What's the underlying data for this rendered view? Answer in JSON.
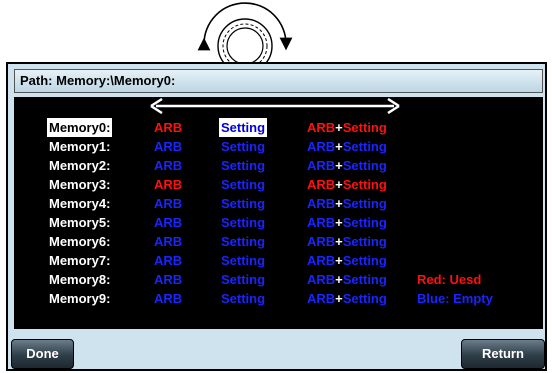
{
  "path_label": "Path: Memory:\\Memory0:",
  "rows": [
    {
      "name": "Memory0:",
      "arb": "ARB",
      "setting": "Setting",
      "both_a": "ARB",
      "both_plus": "+",
      "both_b": "Setting",
      "arb_color": "red",
      "setting_color": "selected",
      "both_color": "red",
      "legend": ""
    },
    {
      "name": "Memory1:",
      "arb": "ARB",
      "setting": "Setting",
      "both_a": "ARB",
      "both_plus": "+",
      "both_b": "Setting",
      "arb_color": "blue",
      "setting_color": "blue",
      "both_color": "blue",
      "legend": ""
    },
    {
      "name": "Memory2:",
      "arb": "ARB",
      "setting": "Setting",
      "both_a": "ARB",
      "both_plus": "+",
      "both_b": "Setting",
      "arb_color": "blue",
      "setting_color": "blue",
      "both_color": "blue",
      "legend": ""
    },
    {
      "name": "Memory3:",
      "arb": "ARB",
      "setting": "Setting",
      "both_a": "ARB",
      "both_plus": "+",
      "both_b": "Setting",
      "arb_color": "red",
      "setting_color": "blue",
      "both_color": "red",
      "legend": ""
    },
    {
      "name": "Memory4:",
      "arb": "ARB",
      "setting": "Setting",
      "both_a": "ARB",
      "both_plus": "+",
      "both_b": "Setting",
      "arb_color": "blue",
      "setting_color": "blue",
      "both_color": "blue",
      "legend": ""
    },
    {
      "name": "Memory5:",
      "arb": "ARB",
      "setting": "Setting",
      "both_a": "ARB",
      "both_plus": "+",
      "both_b": "Setting",
      "arb_color": "blue",
      "setting_color": "blue",
      "both_color": "blue",
      "legend": ""
    },
    {
      "name": "Memory6:",
      "arb": "ARB",
      "setting": "Setting",
      "both_a": "ARB",
      "both_plus": "+",
      "both_b": "Setting",
      "arb_color": "blue",
      "setting_color": "blue",
      "both_color": "blue",
      "legend": ""
    },
    {
      "name": "Memory7:",
      "arb": "ARB",
      "setting": "Setting",
      "both_a": "ARB",
      "both_plus": "+",
      "both_b": "Setting",
      "arb_color": "blue",
      "setting_color": "blue",
      "both_color": "blue",
      "legend": ""
    },
    {
      "name": "Memory8:",
      "arb": "ARB",
      "setting": "Setting",
      "both_a": "ARB",
      "both_plus": "+",
      "both_b": "Setting",
      "arb_color": "blue",
      "setting_color": "blue",
      "both_color": "blue",
      "legend": "Red: Uesd"
    },
    {
      "name": "Memory9:",
      "arb": "ARB",
      "setting": "Setting",
      "both_a": "ARB",
      "both_plus": "+",
      "both_b": "Setting",
      "arb_color": "blue",
      "setting_color": "blue",
      "both_color": "blue",
      "legend": "Blue: Empty"
    }
  ],
  "legend_colors": {
    "used": "#ff1010",
    "empty": "#1a24ff"
  },
  "buttons": {
    "done": "Done",
    "return": "Return"
  },
  "icons": {
    "knob": "rotary-knob-icon",
    "arrow": "double-arrow-icon"
  }
}
